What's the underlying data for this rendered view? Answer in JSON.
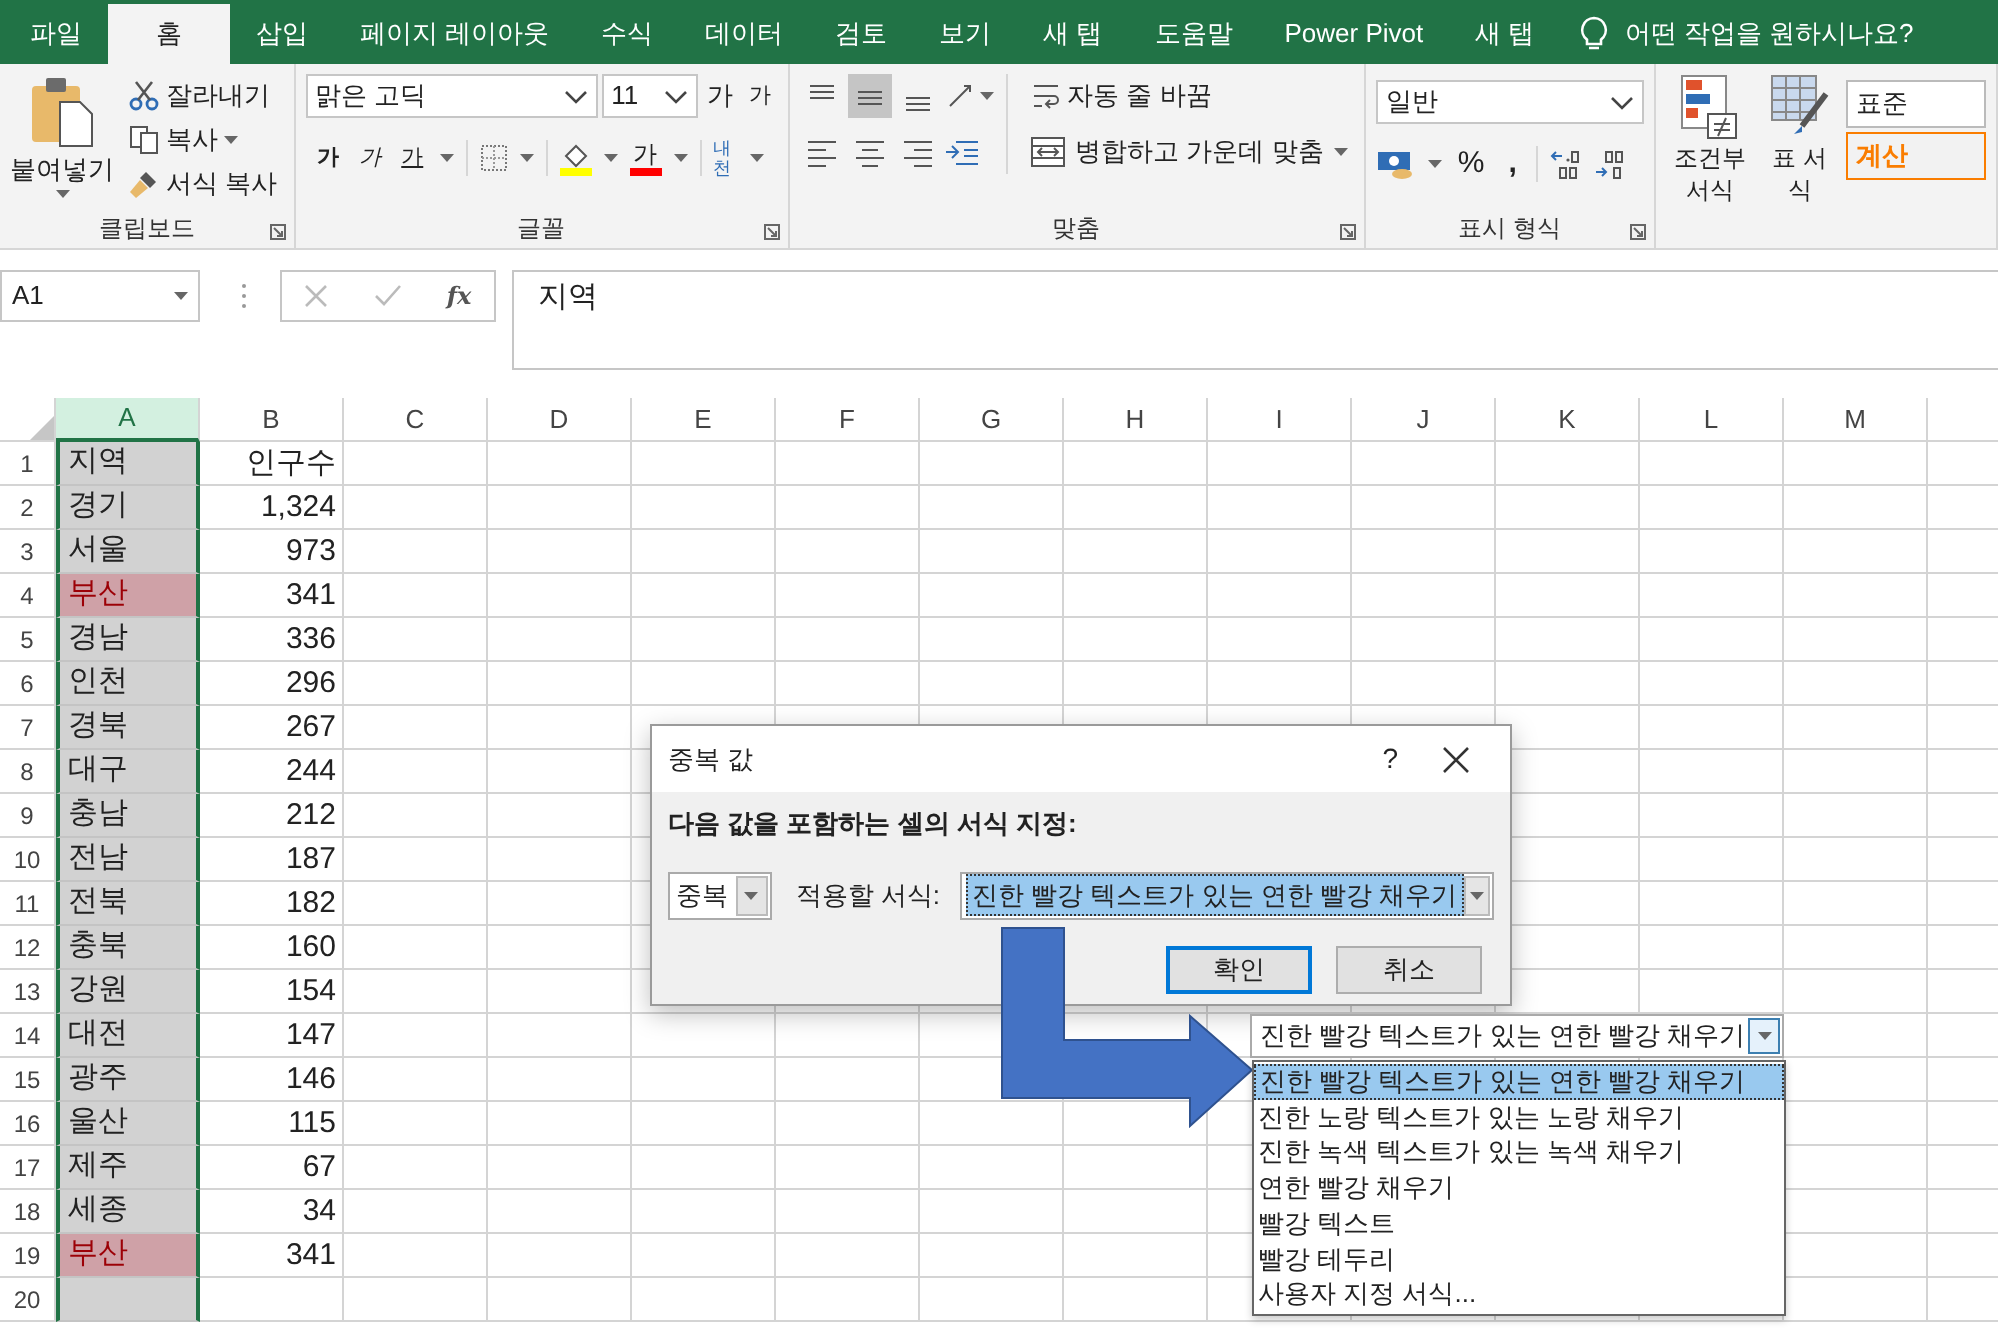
{
  "tabs": [
    {
      "label": "파일",
      "selected": false
    },
    {
      "label": "홈",
      "selected": true
    },
    {
      "label": "삽입",
      "selected": false
    },
    {
      "label": "페이지 레이아웃",
      "selected": false
    },
    {
      "label": "수식",
      "selected": false
    },
    {
      "label": "데이터",
      "selected": false
    },
    {
      "label": "검토",
      "selected": false
    },
    {
      "label": "보기",
      "selected": false
    },
    {
      "label": "새 탭",
      "selected": false
    },
    {
      "label": "도움말",
      "selected": false
    },
    {
      "label": "Power Pivot",
      "selected": false
    },
    {
      "label": "새 탭",
      "selected": false
    }
  ],
  "tell_me": "어떤 작업을 원하시나요?",
  "ribbon": {
    "clipboard": {
      "paste": "붙여넣기",
      "cut": "잘라내기",
      "copy": "복사",
      "format_painter": "서식 복사",
      "label": "클립보드"
    },
    "font": {
      "font_name": "맑은 고딕",
      "font_size": "11",
      "grow": "가",
      "shrink": "가",
      "bold": "가",
      "italic": "가",
      "underline": "가",
      "font_color": "가",
      "phonetic": "내천",
      "label": "글꼴"
    },
    "alignment": {
      "vertical": [
        {
          "selected": false
        },
        {
          "selected": true
        },
        {
          "selected": false
        }
      ],
      "wrap_text": "자동 줄 바꿈",
      "merge_center": "병합하고 가운데 맞춤",
      "label": "맞춤"
    },
    "number": {
      "format": "일반",
      "percent": "%",
      "comma": ",",
      "label": "표시 형식"
    },
    "styles": {
      "conditional": "조건부 서식",
      "format_table": "표 서식",
      "normal": "표준",
      "calculation": "계산"
    }
  },
  "formula_bar": {
    "name_box": "A1",
    "fx": "fx",
    "content": "지역"
  },
  "sheet": {
    "columns": [
      {
        "label": "A",
        "selected": true
      },
      {
        "label": "B",
        "selected": false
      },
      {
        "label": "C",
        "selected": false
      },
      {
        "label": "D",
        "selected": false
      },
      {
        "label": "E",
        "selected": false
      },
      {
        "label": "F",
        "selected": false
      },
      {
        "label": "G",
        "selected": false
      },
      {
        "label": "H",
        "selected": false
      },
      {
        "label": "I",
        "selected": false
      },
      {
        "label": "J",
        "selected": false
      },
      {
        "label": "K",
        "selected": false
      },
      {
        "label": "L",
        "selected": false
      },
      {
        "label": "M",
        "selected": false
      }
    ],
    "rows": [
      {
        "number": "1",
        "a": "지역",
        "b": "인구수",
        "highlighted": false
      },
      {
        "number": "2",
        "a": "경기",
        "b": "1,324",
        "highlighted": false
      },
      {
        "number": "3",
        "a": "서울",
        "b": "973",
        "highlighted": false
      },
      {
        "number": "4",
        "a": "부산",
        "b": "341",
        "highlighted": true
      },
      {
        "number": "5",
        "a": "경남",
        "b": "336",
        "highlighted": false
      },
      {
        "number": "6",
        "a": "인천",
        "b": "296",
        "highlighted": false
      },
      {
        "number": "7",
        "a": "경북",
        "b": "267",
        "highlighted": false
      },
      {
        "number": "8",
        "a": "대구",
        "b": "244",
        "highlighted": false
      },
      {
        "number": "9",
        "a": "충남",
        "b": "212",
        "highlighted": false
      },
      {
        "number": "10",
        "a": "전남",
        "b": "187",
        "highlighted": false
      },
      {
        "number": "11",
        "a": "전북",
        "b": "182",
        "highlighted": false
      },
      {
        "number": "12",
        "a": "충북",
        "b": "160",
        "highlighted": false
      },
      {
        "number": "13",
        "a": "강원",
        "b": "154",
        "highlighted": false
      },
      {
        "number": "14",
        "a": "대전",
        "b": "147",
        "highlighted": false
      },
      {
        "number": "15",
        "a": "광주",
        "b": "146",
        "highlighted": false
      },
      {
        "number": "16",
        "a": "울산",
        "b": "115",
        "highlighted": false
      },
      {
        "number": "17",
        "a": "제주",
        "b": "67",
        "highlighted": false
      },
      {
        "number": "18",
        "a": "세종",
        "b": "34",
        "highlighted": false
      },
      {
        "number": "19",
        "a": "부산",
        "b": "341",
        "highlighted": true
      },
      {
        "number": "20",
        "highlighted": false
      }
    ]
  },
  "dialog": {
    "title": "중복 값",
    "help": "?",
    "heading": "다음 값을 포함하는 셀의 서식 지정:",
    "rule": "중복",
    "format_label": "적용할 서식:",
    "format_value": "진한 빨강 텍스트가 있는 연한 빨강 채우기",
    "ok": "확인",
    "cancel": "취소"
  },
  "dropdown": {
    "value": "진한 빨강 텍스트가 있는 연한 빨강 채우기",
    "options": [
      {
        "label": "진한 빨강 텍스트가 있는 연한 빨강 채우기",
        "selected": true
      },
      {
        "label": "진한 노랑 텍스트가 있는 노랑 채우기",
        "selected": false
      },
      {
        "label": "진한 녹색 텍스트가 있는 녹색 채우기",
        "selected": false
      },
      {
        "label": "연한 빨강 채우기",
        "selected": false
      },
      {
        "label": "빨강 텍스트",
        "selected": false
      },
      {
        "label": "빨강 테두리",
        "selected": false
      },
      {
        "label": "사용자 지정 서식...",
        "selected": false
      }
    ]
  }
}
